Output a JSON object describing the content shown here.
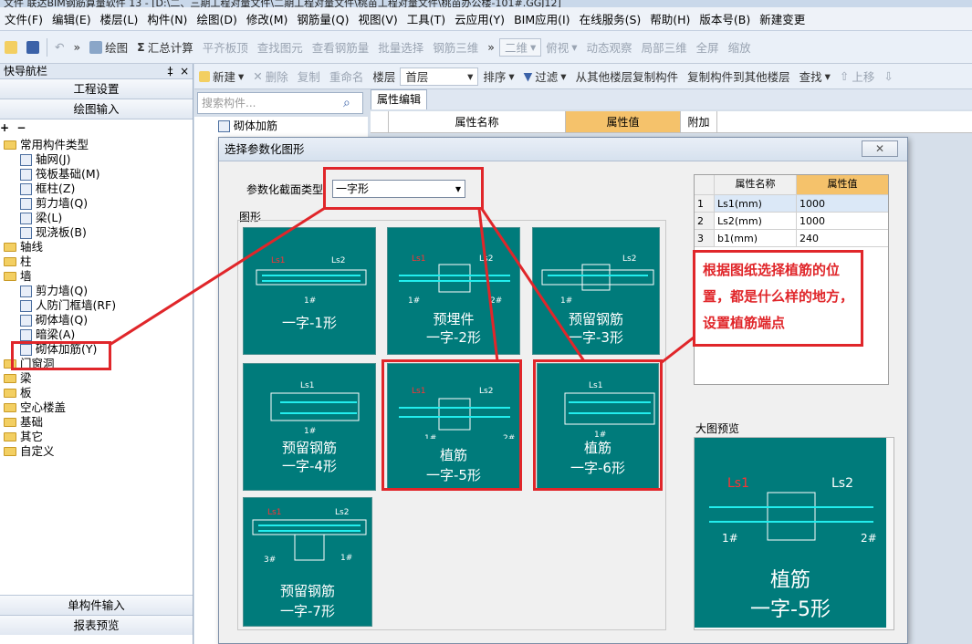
{
  "window": {
    "title": "文件 联达BIM钢筋算量软件 13 - [D:\\二、三期工程对量文件\\二期工程对量文件\\桃苗工程对量文件\\桃苗办公楼-101#.GGJ12]"
  },
  "menu": [
    "文件(F)",
    "编辑(E)",
    "楼层(L)",
    "构件(N)",
    "绘图(D)",
    "修改(M)",
    "钢筋量(Q)",
    "视图(V)",
    "工具(T)",
    "云应用(Y)",
    "BIM应用(I)",
    "在线服务(S)",
    "帮助(H)",
    "版本号(B)",
    "新建变更"
  ],
  "toolbar": {
    "draw": "绘图",
    "sum": "汇总计算",
    "align": "平齐板顶",
    "find": "查找图元",
    "view_rebar": "查看钢筋量",
    "batch": "批量选择",
    "rebar3d": "钢筋三维",
    "view2d": "二维",
    "top": "俯视",
    "dyn": "动态观察",
    "local3d": "局部三维",
    "full": "全屏",
    "zoom": "缩放"
  },
  "nav": {
    "title": "快导航栏",
    "pin": "‡",
    "close": "×",
    "eng_setup": "工程设置",
    "draw_input": "绘图输入",
    "tree": [
      {
        "label": "常用构件类型",
        "level": 0,
        "kind": "folder",
        "open": true
      },
      {
        "label": "轴网(J)",
        "level": 1,
        "kind": "item"
      },
      {
        "label": "筏板基础(M)",
        "level": 1,
        "kind": "item"
      },
      {
        "label": "框柱(Z)",
        "level": 1,
        "kind": "item"
      },
      {
        "label": "剪力墙(Q)",
        "level": 1,
        "kind": "item"
      },
      {
        "label": "梁(L)",
        "level": 1,
        "kind": "item"
      },
      {
        "label": "现浇板(B)",
        "level": 1,
        "kind": "item"
      },
      {
        "label": "轴线",
        "level": 0,
        "kind": "folder"
      },
      {
        "label": "柱",
        "level": 0,
        "kind": "folder"
      },
      {
        "label": "墙",
        "level": 0,
        "kind": "folder",
        "open": true
      },
      {
        "label": "剪力墙(Q)",
        "level": 1,
        "kind": "item"
      },
      {
        "label": "人防门框墙(RF)",
        "level": 1,
        "kind": "item"
      },
      {
        "label": "砌体墙(Q)",
        "level": 1,
        "kind": "item"
      },
      {
        "label": "暗梁(A)",
        "level": 1,
        "kind": "item"
      },
      {
        "label": "砌体加筋(Y)",
        "level": 1,
        "kind": "item"
      },
      {
        "label": "门窗洞",
        "level": 0,
        "kind": "folder"
      },
      {
        "label": "梁",
        "level": 0,
        "kind": "folder"
      },
      {
        "label": "板",
        "level": 0,
        "kind": "folder"
      },
      {
        "label": "空心楼盖",
        "level": 0,
        "kind": "folder"
      },
      {
        "label": "基础",
        "level": 0,
        "kind": "folder"
      },
      {
        "label": "其它",
        "level": 0,
        "kind": "folder"
      },
      {
        "label": "自定义",
        "level": 0,
        "kind": "folder"
      }
    ],
    "single_input": "单构件输入",
    "report": "报表预览"
  },
  "tool2": {
    "new": "新建",
    "delete": "删除",
    "copy": "复制",
    "rename": "重命名",
    "floor_label": "楼层",
    "floor_value": "首层",
    "sort": "排序",
    "filter": "过滤",
    "copy_from": "从其他楼层复制构件",
    "copy_to": "复制构件到其他楼层",
    "find": "查找",
    "up": "上移",
    "down": "下移"
  },
  "search": {
    "placeholder": "搜索构件..."
  },
  "component_list": [
    "砌体加筋"
  ],
  "prop_panel": {
    "tab": "属性编辑",
    "col_name": "属性名称",
    "col_value": "属性值",
    "col_extra": "附加"
  },
  "dialog": {
    "title": "选择参数化图形",
    "close": "✕",
    "section_type_label": "参数化截面类型",
    "section_type_value": "一字形",
    "shapes_label": "图形",
    "tiles": [
      {
        "line1": "一字-1形",
        "line2": ""
      },
      {
        "line1": "预埋件",
        "line2": "一字-2形"
      },
      {
        "line1": "预留钢筋",
        "line2": "一字-3形"
      },
      {
        "line1": "预留钢筋",
        "line2": "一字-4形"
      },
      {
        "line1": "植筋",
        "line2": "一字-5形"
      },
      {
        "line1": "植筋",
        "line2": "一字-6形"
      },
      {
        "line1": "预留钢筋",
        "line2": "一字-7形"
      }
    ],
    "params": {
      "col_name": "属性名称",
      "col_value": "属性值",
      "rows": [
        {
          "idx": "1",
          "name": "Ls1(mm)",
          "value": "1000"
        },
        {
          "idx": "2",
          "name": "Ls2(mm)",
          "value": "1000"
        },
        {
          "idx": "3",
          "name": "b1(mm)",
          "value": "240"
        }
      ]
    },
    "preview_label": "大图预览",
    "preview_line1": "植筋",
    "preview_line2": "一字-5形"
  },
  "annotation": "根据图纸选择植筋的位置，都是什么样的地方，设置植筋端点",
  "colors": {
    "tile": "#007b7b",
    "accent_red": "#e0262a",
    "header_orange": "#f5c26b"
  }
}
